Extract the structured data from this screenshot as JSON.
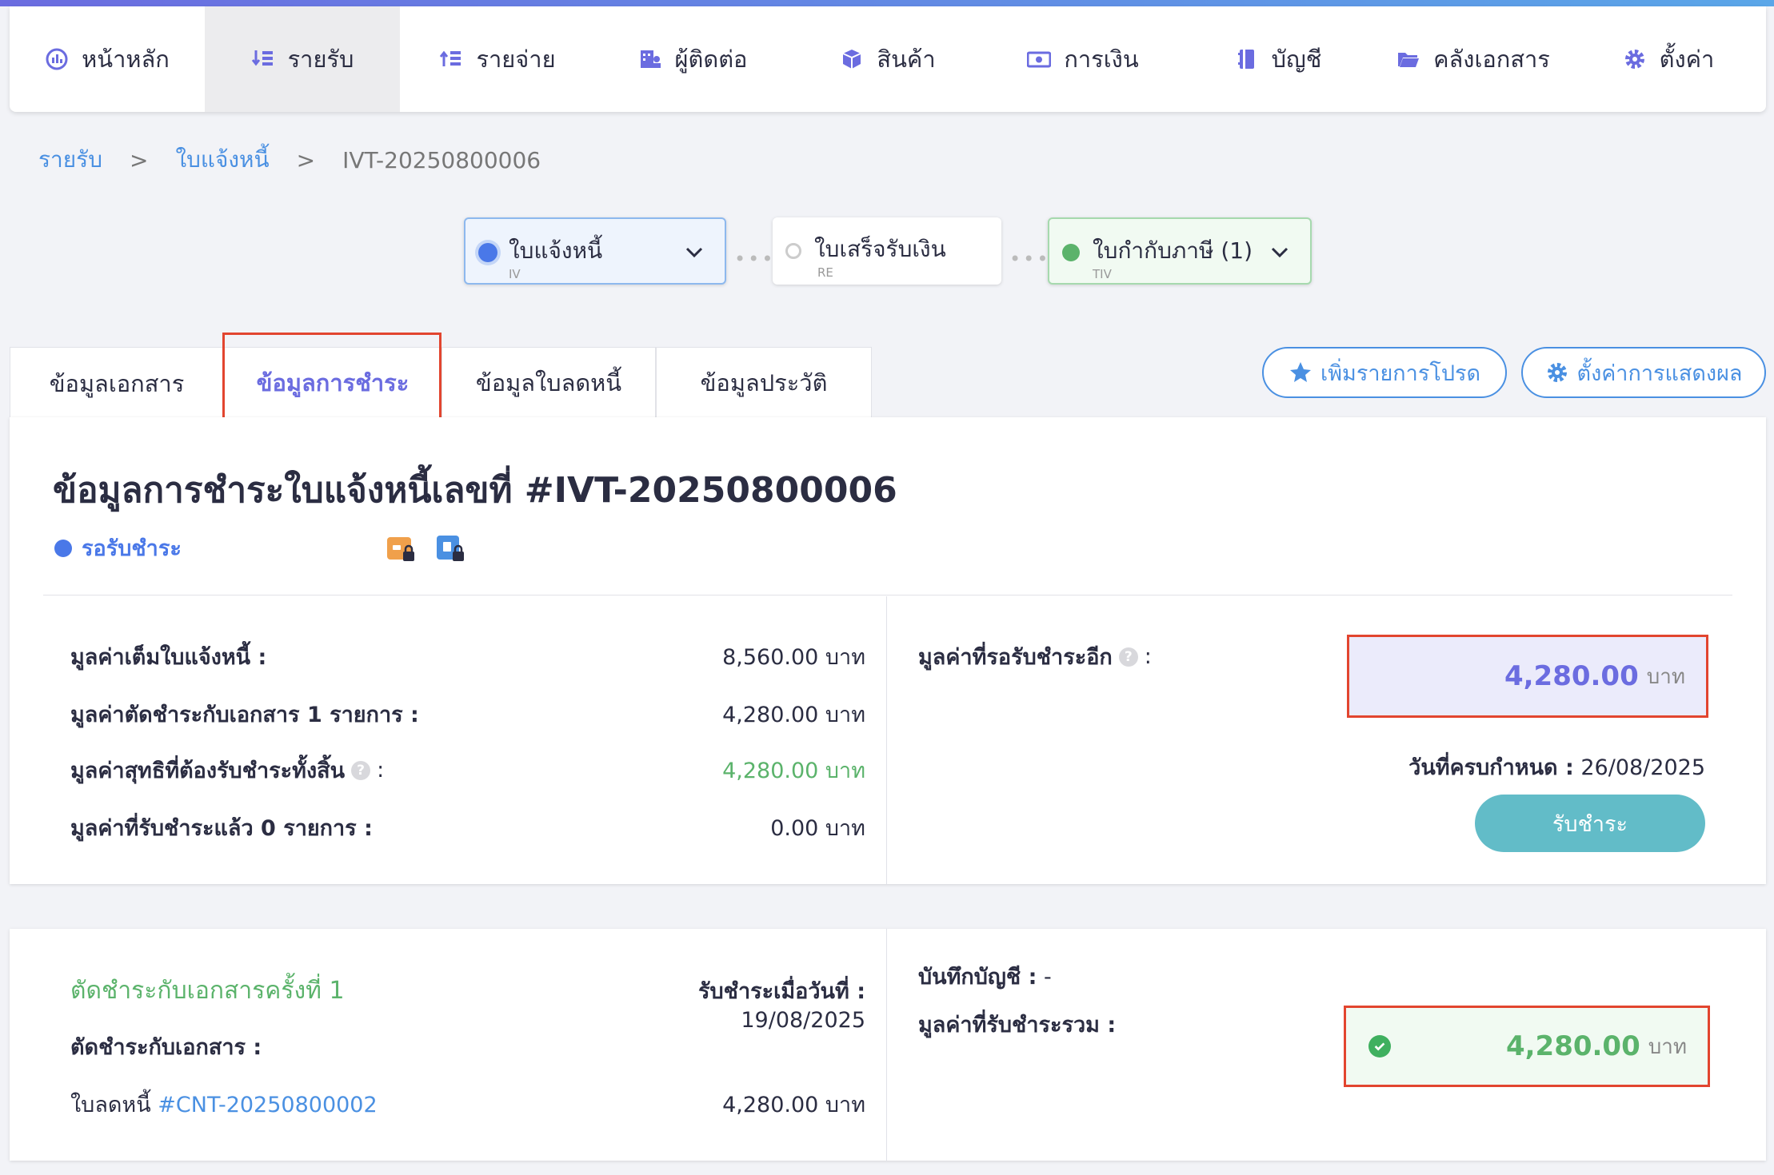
{
  "nav": {
    "items": [
      {
        "label": "หน้าหลัก",
        "icon": "dashboard-icon"
      },
      {
        "label": "รายรับ",
        "icon": "income-icon",
        "active": true
      },
      {
        "label": "รายจ่าย",
        "icon": "expense-icon"
      },
      {
        "label": "ผู้ติดต่อ",
        "icon": "contacts-icon"
      },
      {
        "label": "สินค้า",
        "icon": "box-icon"
      },
      {
        "label": "การเงิน",
        "icon": "money-icon"
      },
      {
        "label": "บัญชี",
        "icon": "book-icon"
      },
      {
        "label": "คลังเอกสาร",
        "icon": "folder-icon"
      },
      {
        "label": "ตั้งค่า",
        "icon": "gear-icon"
      }
    ]
  },
  "breadcrumb": {
    "level1": "รายรับ",
    "sep": ">",
    "level2": "ใบแจ้งหนี้",
    "current": "IVT-20250800006"
  },
  "flow": {
    "steps": [
      {
        "title": "ใบแจ้งหนี้",
        "code": "IV"
      },
      {
        "title": "ใบเสร็จรับเงิน",
        "code": "RE"
      },
      {
        "title": "ใบกำกับภาษี (1)",
        "code": "TIV"
      }
    ],
    "connector": "•••"
  },
  "tabs": [
    "ข้อมูลเอกสาร",
    "ข้อมูลการชำระ",
    "ข้อมูลใบลดหนี้",
    "ข้อมูลประวัติ"
  ],
  "actions": {
    "favorite": "เพิ่มรายการโปรด",
    "display_settings": "ตั้งค่าการแสดงผล"
  },
  "payment": {
    "title": "ข้อมูลการชำระใบแจ้งหนี้เลขที่ #IVT-20250800006",
    "status": "รอรับชำระ",
    "rows": [
      {
        "label": "มูลค่าเต็มใบแจ้งหนี้ :",
        "value": "8,560.00 บาท"
      },
      {
        "label": "มูลค่าตัดชำระกับเอกสาร 1 รายการ :",
        "value": "4,280.00 บาท"
      },
      {
        "label": "มูลค่าสุทธิที่ต้องรับชำระทั้งสิ้น",
        "suffix": ":",
        "value": "4,280.00 บาท"
      },
      {
        "label": "มูลค่าที่รับชำระแล้ว 0 รายการ :",
        "value": "0.00 บาท"
      }
    ],
    "remaining_label": "มูลค่าที่รอรับชำระอีก",
    "remaining_suffix": ":",
    "remaining_amount": "4,280.00",
    "unit": "บาท",
    "due_label": "วันที่ครบกำหนด :",
    "due_date": "26/08/2025",
    "pay_button": "รับชำระ",
    "help_glyph": "?"
  },
  "settlement": {
    "title": "ตัดชำระกับเอกสารครั้งที่ 1",
    "received_label": "รับชำระเมื่อวันที่ :",
    "received_date": "19/08/2025",
    "doc_label": "ตัดชำระกับเอกสาร :",
    "doc_prefix": "ใบลดหนี้",
    "doc_link": "#CNT-20250800002",
    "doc_amount": "4,280.00 บาท",
    "ledger_label": "บันทึกบัญชี :",
    "ledger_value": "-",
    "total_label": "มูลค่าที่รับชำระรวม :",
    "total_amount": "4,280.00",
    "unit": "บาท"
  },
  "colors": {
    "accent": "#6b6ce0",
    "link": "#4a90e2",
    "success": "#5bb36b",
    "highlight": "#e2452f",
    "button": "#62bcc8"
  }
}
